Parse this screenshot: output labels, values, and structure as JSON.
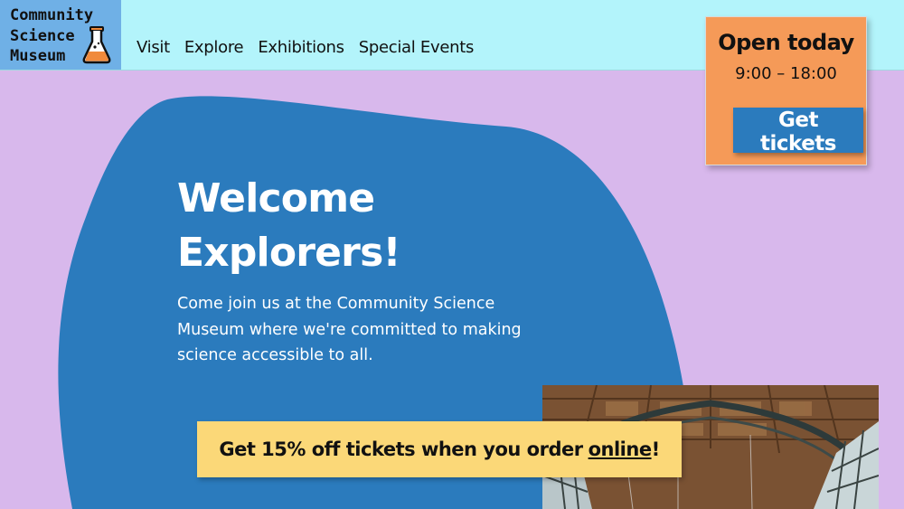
{
  "logo": {
    "lines": [
      "Community",
      "Science",
      "Museum"
    ],
    "icon": "flask-icon"
  },
  "nav": {
    "items": [
      "Visit",
      "Explore",
      "Exhibitions",
      "Special Events"
    ]
  },
  "open_card": {
    "title": "Open today",
    "hours": "9:00 – 18:00",
    "button": "Get tickets"
  },
  "hero": {
    "title_lines": [
      "Welcome",
      "Explorers!"
    ],
    "description": "Come join us at the Community Science Museum where we're committed to making science accessible to all."
  },
  "promo": {
    "text": "Get 15% off tickets when you order",
    "link": "online",
    "end": "!"
  },
  "colors": {
    "background": "#d8b8ec",
    "header": "#b3f4fb",
    "logo_bg": "#6fb0e6",
    "hero_blob": "#2b7bbd",
    "open_card": "#f59a58",
    "promo": "#fbd878"
  }
}
